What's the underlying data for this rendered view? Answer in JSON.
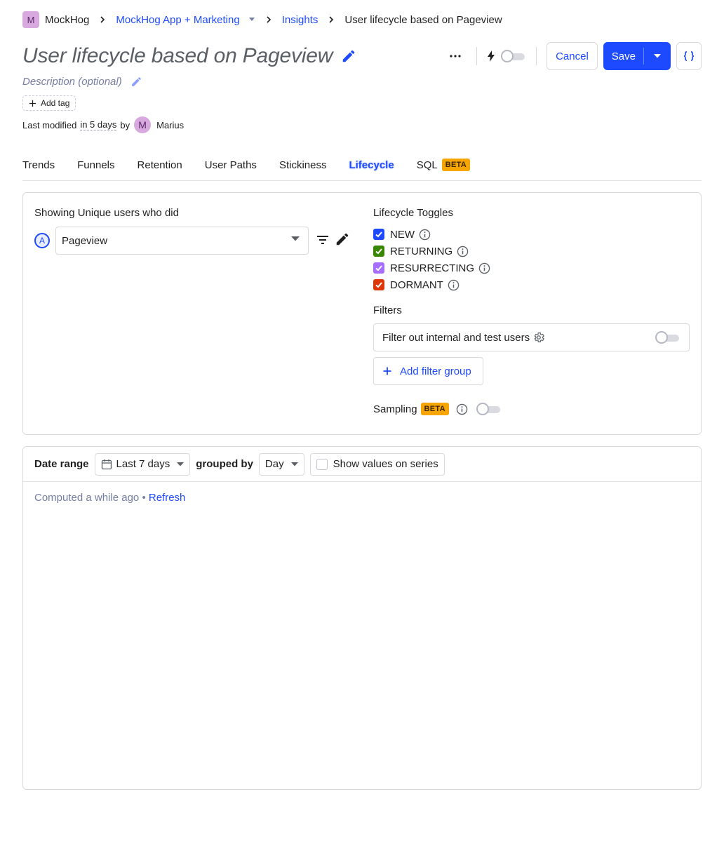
{
  "breadcrumb": {
    "org_initial": "M",
    "org_name": "MockHog",
    "project": "MockHog App + Marketing",
    "section": "Insights",
    "current": "User lifecycle based on Pageview"
  },
  "insight": {
    "title": "User lifecycle based on Pageview",
    "description_placeholder": "Description (optional)",
    "add_tag_label": "Add tag",
    "last_modified_label": "Last modified",
    "last_modified_when": "in 5 days",
    "by_label": "by",
    "author_initial": "M",
    "author_name": "Marius"
  },
  "actions": {
    "cancel_label": "Cancel",
    "save_label": "Save"
  },
  "tabs": [
    {
      "label": "Trends"
    },
    {
      "label": "Funnels"
    },
    {
      "label": "Retention"
    },
    {
      "label": "User Paths"
    },
    {
      "label": "Stickiness"
    },
    {
      "label": "Lifecycle",
      "active": true
    },
    {
      "label": "SQL",
      "badge": "BETA"
    }
  ],
  "series": {
    "heading": "Showing Unique users who did",
    "letter": "A",
    "event": "Pageview"
  },
  "lifecycle": {
    "heading": "Lifecycle Toggles",
    "toggles": [
      {
        "label": "NEW",
        "color": "#1d4aff",
        "checked": true
      },
      {
        "label": "RETURNING",
        "color": "#388600",
        "checked": true
      },
      {
        "label": "RESURRECTING",
        "color": "#a56eff",
        "checked": true
      },
      {
        "label": "DORMANT",
        "color": "#db3707",
        "checked": true
      }
    ]
  },
  "filters": {
    "heading": "Filters",
    "internal_label": "Filter out internal and test users",
    "add_group_label": "Add filter group"
  },
  "sampling": {
    "label": "Sampling",
    "badge": "BETA"
  },
  "results": {
    "date_range_label": "Date range",
    "date_range_value": "Last 7 days",
    "grouped_by_label": "grouped by",
    "interval_value": "Day",
    "show_values_label": "Show values on series",
    "computed_text": "Computed a while ago",
    "separator": "•",
    "refresh_label": "Refresh"
  },
  "colors": {
    "accent": "#1d4aff",
    "beta_badge": "#f7a501"
  }
}
